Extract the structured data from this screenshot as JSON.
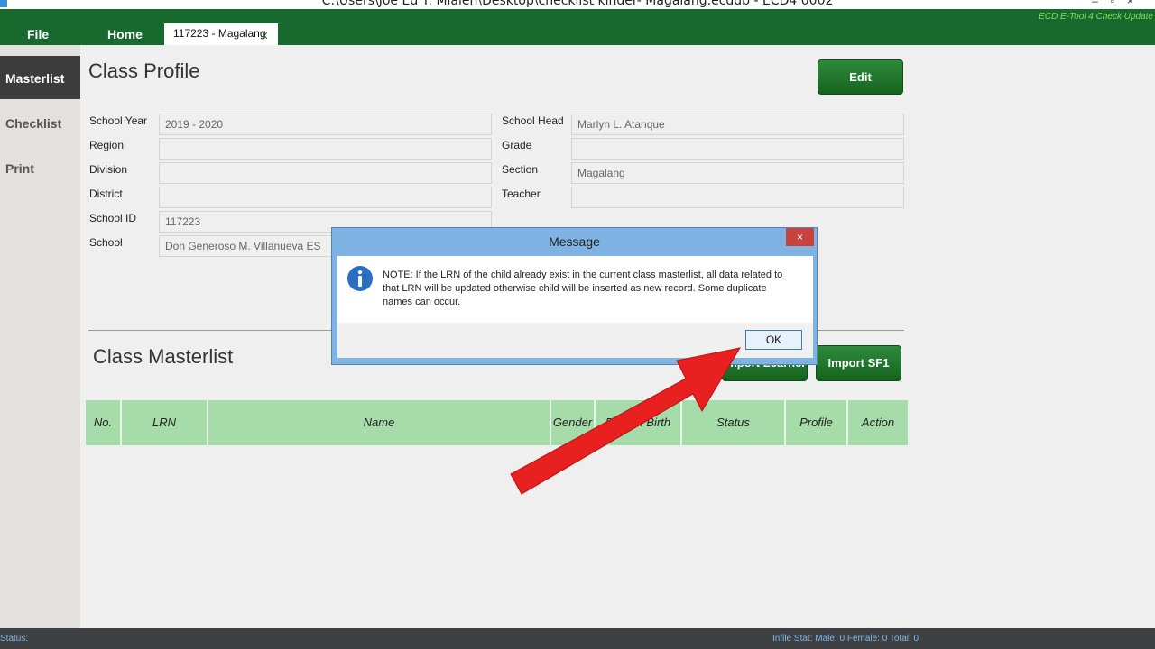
{
  "window": {
    "title": "C:\\Users\\Joe Ed T. Mialen\\Desktop\\checklist kinder- Magalang.ecddb  -  ECD4 0002"
  },
  "menu": {
    "file": "File",
    "home": "Home",
    "doc_tab": "117223  -   Magalang",
    "doc_tab_close": "x",
    "update_link": "ECD E-Tool 4 Check Update"
  },
  "sidebar": {
    "items": [
      {
        "label": "Masterlist",
        "active": true
      },
      {
        "label": "Checklist",
        "active": false
      },
      {
        "label": "Print",
        "active": false
      }
    ]
  },
  "class_profile": {
    "heading": "Class Profile",
    "edit_label": "Edit",
    "fields": {
      "school_year": {
        "label": "School Year",
        "value": "2019 - 2020"
      },
      "region": {
        "label": "Region",
        "value": ""
      },
      "division": {
        "label": "Division",
        "value": ""
      },
      "district": {
        "label": "District",
        "value": ""
      },
      "school_id": {
        "label": "School ID",
        "value": "117223"
      },
      "school": {
        "label": "School",
        "value": "Don Generoso M. Villanueva ES"
      },
      "school_head": {
        "label": "School Head",
        "value": "Marlyn L. Atanque"
      },
      "grade": {
        "label": "Grade",
        "value": ""
      },
      "section": {
        "label": "Section",
        "value": "Magalang"
      },
      "teacher": {
        "label": "Teacher",
        "value": ""
      }
    }
  },
  "masterlist": {
    "heading": "Class Masterlist",
    "import_learner_label": "Import Learner",
    "import_sf1_label": "Import SF1",
    "columns": [
      "No.",
      "LRN",
      "Name",
      "Gender",
      "Date of Birth",
      "Status",
      "Profile",
      "Action"
    ]
  },
  "status": {
    "left": "Status:",
    "right": "Infile Stat:  Male: 0  Female: 0   Total: 0"
  },
  "dialog": {
    "title": "Message",
    "close": "×",
    "icon": "info-icon",
    "message": "NOTE: If the LRN of the child already exist in the current class masterlist, all data related to that LRN will be updated otherwise child will be inserted as new record. Some duplicate names can occur.",
    "ok_label": "OK"
  },
  "colors": {
    "menubar": "#17692e",
    "table_header": "#a6dca9",
    "dialog_frame": "#7fb3e3",
    "annotation_arrow": "#e8201f"
  }
}
